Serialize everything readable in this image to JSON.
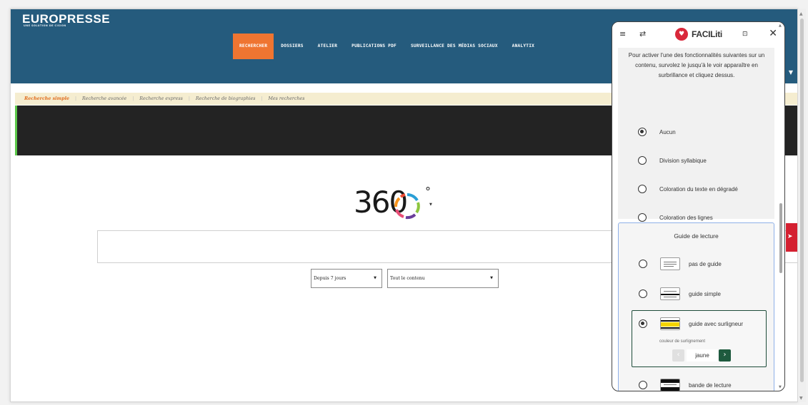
{
  "header": {
    "logo": "EUROPRESSE",
    "logo_sub": "UNE SOLUTION DE CISION",
    "nav": [
      "RECHERCHER",
      "DOSSIERS",
      "ATELIER",
      "PUBLICATIONS PDF",
      "SURVEILLANCE DES MÉDIAS SOCIAUX",
      "ANALYTIX"
    ],
    "nav_active": "RECHERCHER"
  },
  "search_tabs": [
    "Recherche simple",
    "Recherche avancée",
    "Recherche express",
    "Recherche de biographies",
    "Mes recherches"
  ],
  "logo360": {
    "text": "360",
    "degree": "°"
  },
  "search": {
    "period": "Depuis 7 jours",
    "content": "Tout le contenu"
  },
  "panel": {
    "brand": "FACILiti",
    "description": "Pour activer l'une des fonctionnalités suivantes sur un contenu, survolez le jusqu'à le voir apparaître en surbrillance et cliquez dessus.",
    "options": [
      {
        "label": "Aucun",
        "selected": true
      },
      {
        "label": "Division syllabique",
        "selected": false
      },
      {
        "label": "Coloration du texte en dégradé",
        "selected": false
      },
      {
        "label": "Coloration des lignes",
        "selected": false
      }
    ],
    "guide_title": "Guide de lecture",
    "guides": [
      {
        "label": "pas de guide",
        "selected": false
      },
      {
        "label": "guide simple",
        "selected": false
      },
      {
        "label": "guide avec surligneur",
        "selected": true
      },
      {
        "label": "bande de lecture",
        "selected": false
      }
    ],
    "highlight_label": "couleur de surlignement",
    "highlight_value": "jaune",
    "colors": {
      "brand": "#d9283a",
      "accent": "#1e5a3e",
      "highlight": "#f5d400"
    }
  }
}
